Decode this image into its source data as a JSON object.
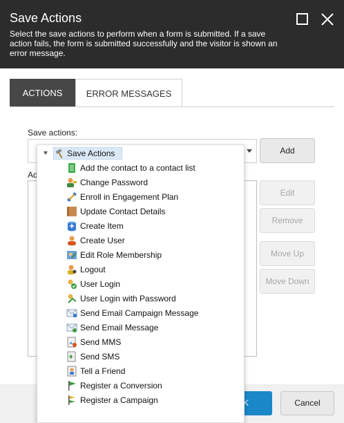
{
  "dialog": {
    "title": "Save Actions",
    "description": "Select the save actions to perform when a form is submitted. If a save action fails, the form is submitted successfully and the visitor is shown an error message."
  },
  "tabs": [
    {
      "label": "ACTIONS",
      "active": true
    },
    {
      "label": "ERROR MESSAGES",
      "active": false
    }
  ],
  "form": {
    "save_actions_label": "Save actions:",
    "added_label": "Ad"
  },
  "buttons": {
    "add": "Add",
    "edit": "Edit",
    "remove": "Remove",
    "move_up": "Move Up",
    "move_down": "Move Down",
    "ok": "K",
    "cancel": "Cancel"
  },
  "tree": {
    "root": "Save Actions",
    "items": [
      {
        "label": "Add the contact to a contact list",
        "icon": "contact-list-icon"
      },
      {
        "label": "Change Password",
        "icon": "change-password-icon"
      },
      {
        "label": "Enroll in Engagement Plan",
        "icon": "engagement-plan-icon"
      },
      {
        "label": "Update Contact Details",
        "icon": "contact-details-icon"
      },
      {
        "label": "Create Item",
        "icon": "create-item-icon"
      },
      {
        "label": "Create User",
        "icon": "create-user-icon"
      },
      {
        "label": "Edit Role Membership",
        "icon": "role-membership-icon"
      },
      {
        "label": "Logout",
        "icon": "logout-icon"
      },
      {
        "label": "User Login",
        "icon": "user-login-icon"
      },
      {
        "label": "User Login with Password",
        "icon": "login-password-icon"
      },
      {
        "label": "Send Email Campaign Message",
        "icon": "email-campaign-icon"
      },
      {
        "label": "Send Email Message",
        "icon": "email-message-icon"
      },
      {
        "label": "Send MMS",
        "icon": "mms-icon"
      },
      {
        "label": "Send SMS",
        "icon": "sms-icon"
      },
      {
        "label": "Tell a Friend",
        "icon": "tell-friend-icon"
      },
      {
        "label": "Register a Conversion",
        "icon": "conversion-flag-icon"
      },
      {
        "label": "Register a Campaign",
        "icon": "campaign-icon"
      }
    ]
  },
  "colors": {
    "header_bg": "#2c2c2c",
    "active_tab_bg": "#474747",
    "ok_button": "#1a87c9",
    "selection": "#dbe9f7"
  }
}
